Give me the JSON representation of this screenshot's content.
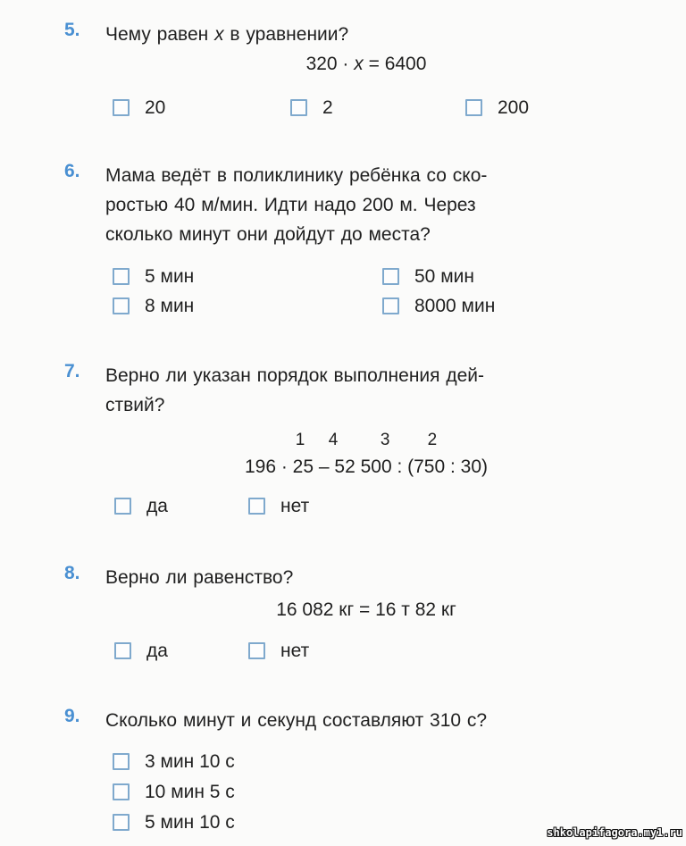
{
  "page": {
    "background_color": "#fbfbfa",
    "number_color": "#4a90d2",
    "checkbox_border_color": "#7fa9cd",
    "text_color": "#1f1f1f"
  },
  "questions": [
    {
      "number": "5.",
      "prompt_prefix": "Чему  равен  ",
      "prompt_var": "x",
      "prompt_suffix": "  в  уравнении?",
      "formula": "320 · x = 6400",
      "formula_left": "320 · ",
      "formula_var": "x",
      "formula_right": " = 6400",
      "answers": [
        {
          "label": "20"
        },
        {
          "label": "2"
        },
        {
          "label": "200"
        }
      ]
    },
    {
      "number": "6.",
      "line1": "Мама  ведёт  в  поликлинику  ребёнка  со  ско-",
      "line2": "ростью  40 м/мин.  Идти  надо  200 м.  Через",
      "line3": "сколько  минут  они  дойдут  до  места?",
      "answers": [
        {
          "label": "5 мин"
        },
        {
          "label": "50 мин"
        },
        {
          "label": "8 мин"
        },
        {
          "label": "8000 мин"
        }
      ]
    },
    {
      "number": "7.",
      "line1": "Верно  ли  указан  порядок  выполнения  дей-",
      "line2": "ствий?",
      "order_digits": "1     4         3        2",
      "formula": "196 · 25 – 52 500 : (750 : 30)",
      "answers": [
        {
          "label": "да"
        },
        {
          "label": "нет"
        }
      ]
    },
    {
      "number": "8.",
      "line1": "Верно  ли  равенство?",
      "formula": "16 082 кг = 16 т 82 кг",
      "answers": [
        {
          "label": "да"
        },
        {
          "label": "нет"
        }
      ]
    },
    {
      "number": "9.",
      "line1": "Сколько  минут  и  секунд  составляют  310 с?",
      "answers": [
        {
          "label": "3 мин 10 с"
        },
        {
          "label": "10 мин 5 с"
        },
        {
          "label": "5 мин 10 с"
        }
      ]
    }
  ],
  "watermark": {
    "text": "shkolapifagora.my1.ru"
  }
}
